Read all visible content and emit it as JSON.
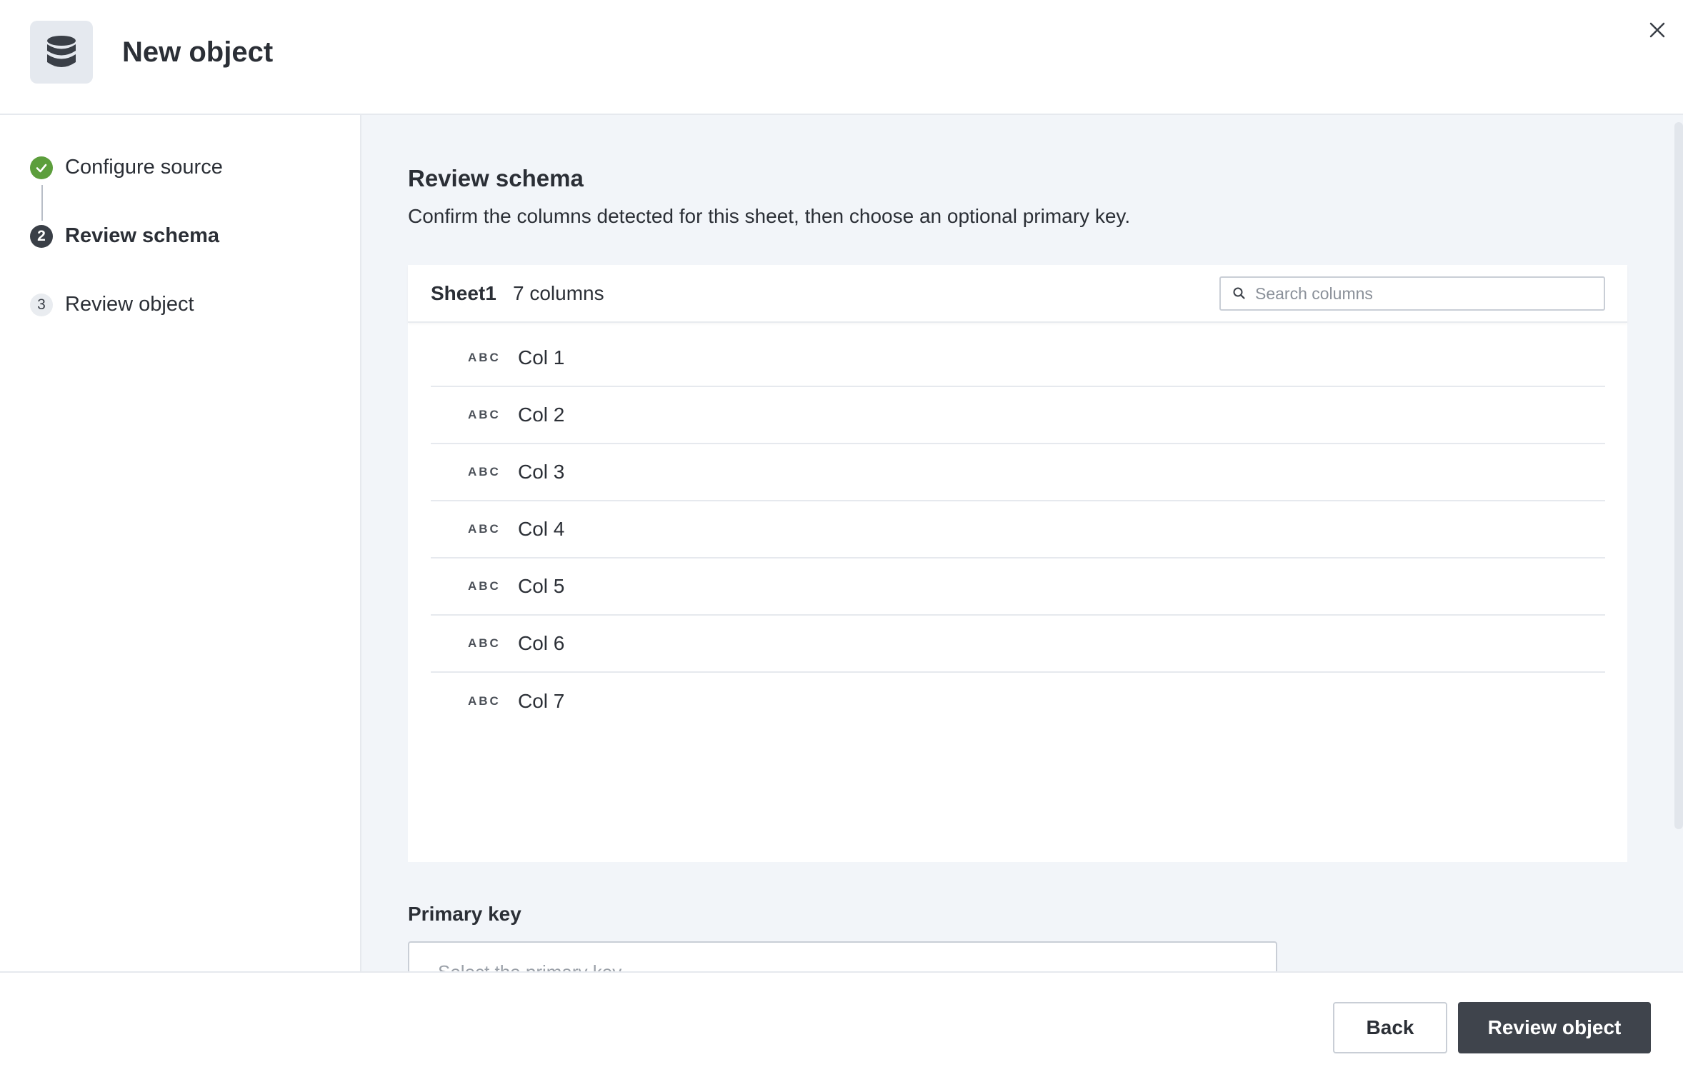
{
  "header": {
    "title": "New object",
    "icon": "database-icon"
  },
  "steps": [
    {
      "number": "1",
      "label": "Configure source",
      "status": "complete"
    },
    {
      "number": "2",
      "label": "Review schema",
      "status": "active"
    },
    {
      "number": "3",
      "label": "Review object",
      "status": "pending"
    }
  ],
  "main": {
    "title": "Review schema",
    "description": "Confirm the columns detected for this sheet, then choose an optional primary key."
  },
  "schema": {
    "sheet_name": "Sheet1",
    "column_count": "7 columns",
    "search_placeholder": "Search columns",
    "columns": [
      {
        "type": "ABC",
        "name": "Col 1"
      },
      {
        "type": "ABC",
        "name": "Col 2"
      },
      {
        "type": "ABC",
        "name": "Col 3"
      },
      {
        "type": "ABC",
        "name": "Col 4"
      },
      {
        "type": "ABC",
        "name": "Col 5"
      },
      {
        "type": "ABC",
        "name": "Col 6"
      },
      {
        "type": "ABC",
        "name": "Col 7"
      }
    ]
  },
  "primary_key": {
    "label": "Primary key",
    "placeholder": "Select the primary key"
  },
  "footer": {
    "back_label": "Back",
    "next_label": "Review object"
  },
  "colors": {
    "success": "#5c9e3c",
    "primary_button": "#3f444c",
    "panel_background": "#f2f5f9"
  }
}
